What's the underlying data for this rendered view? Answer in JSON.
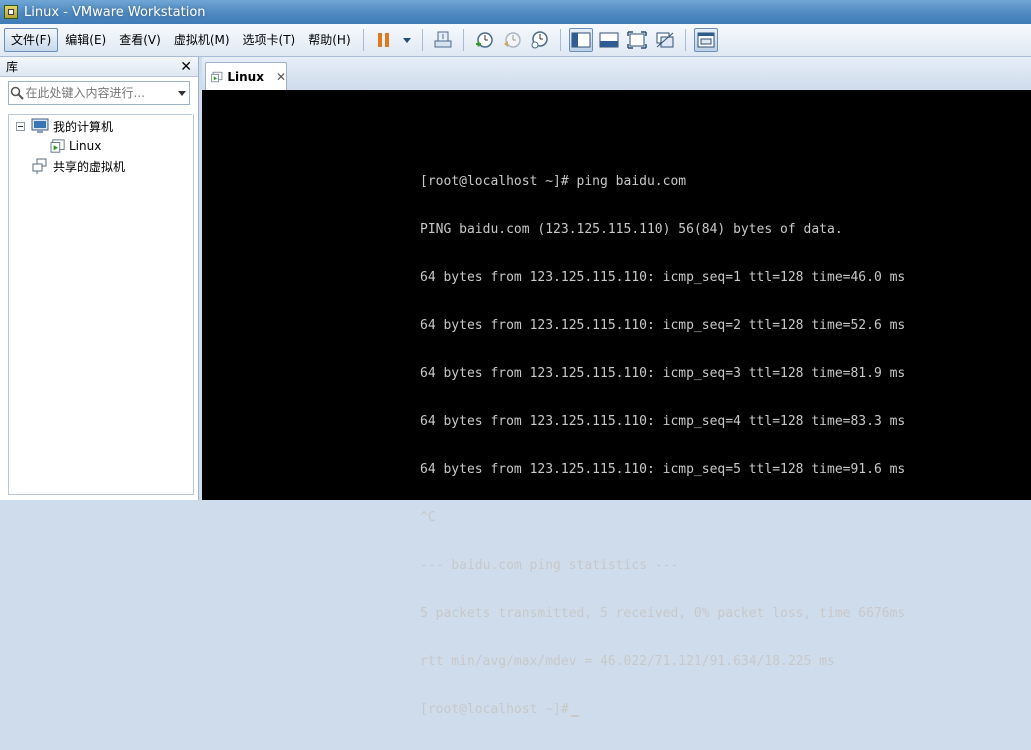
{
  "window": {
    "title": "Linux - VMware Workstation"
  },
  "menu": {
    "items": [
      {
        "label": "文件(F)"
      },
      {
        "label": "编辑(E)"
      },
      {
        "label": "查看(V)"
      },
      {
        "label": "虚拟机(M)"
      },
      {
        "label": "选项卡(T)"
      },
      {
        "label": "帮助(H)"
      }
    ]
  },
  "toolbar": {
    "icons": [
      "pause-icon",
      "dropdown-icon",
      "send-ctrl-alt-del-icon",
      "snapshot-take-icon",
      "snapshot-revert-icon",
      "snapshot-manager-icon",
      "library-view-icon",
      "console-view-icon",
      "fullscreen-icon",
      "unity-icon",
      "thumbnail-view-icon"
    ],
    "accent_color": "#e07a20"
  },
  "library": {
    "title": "库",
    "search_placeholder": "在此处键入内容进行...",
    "tree": [
      {
        "label": "我的计算机"
      },
      {
        "label": "Linux"
      },
      {
        "label": "共享的虚拟机"
      }
    ]
  },
  "tabs": [
    {
      "label": "Linux"
    }
  ],
  "terminal": {
    "lines": [
      "[root@localhost ~]# ping baidu.com",
      "PING baidu.com (123.125.115.110) 56(84) bytes of data.",
      "64 bytes from 123.125.115.110: icmp_seq=1 ttl=128 time=46.0 ms",
      "64 bytes from 123.125.115.110: icmp_seq=2 ttl=128 time=52.6 ms",
      "64 bytes from 123.125.115.110: icmp_seq=3 ttl=128 time=81.9 ms",
      "64 bytes from 123.125.115.110: icmp_seq=4 ttl=128 time=83.3 ms",
      "64 bytes from 123.125.115.110: icmp_seq=5 ttl=128 time=91.6 ms",
      "^C",
      "--- baidu.com ping statistics ---",
      "5 packets transmitted, 5 received, 0% packet loss, time 6676ms",
      "rtt min/avg/max/mdev = 46.022/71.121/91.634/18.225 ms"
    ],
    "prompt": "[root@localhost ~]#",
    "text_color": "#c8c8c8",
    "background": "#000000"
  }
}
